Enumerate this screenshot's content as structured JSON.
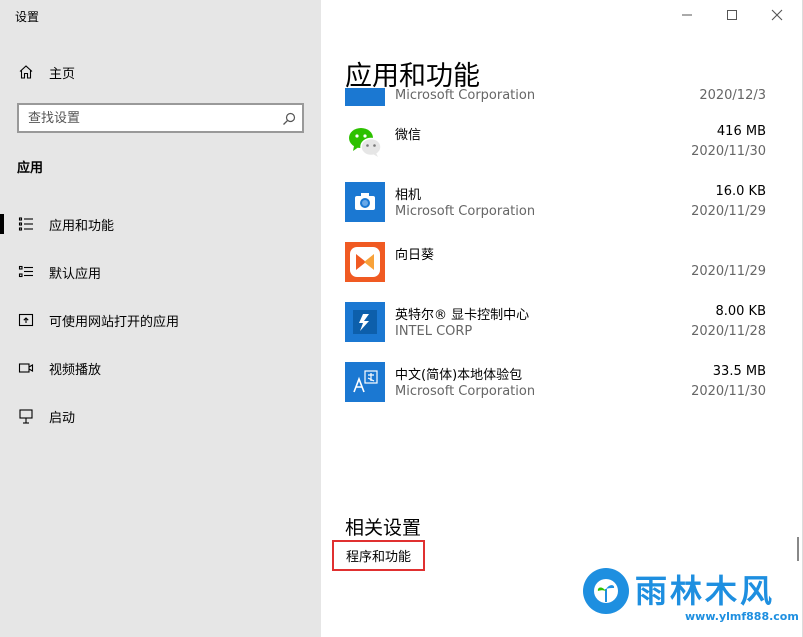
{
  "window": {
    "title": "设置"
  },
  "sidebar": {
    "home_label": "主页",
    "search": {
      "placeholder": "查找设置"
    },
    "section_label": "应用",
    "items": [
      {
        "label": "应用和功能",
        "icon": "apps-features-icon",
        "active": true
      },
      {
        "label": "默认应用",
        "icon": "default-apps-icon",
        "active": false
      },
      {
        "label": "可使用网站打开的应用",
        "icon": "apps-for-websites-icon",
        "active": false
      },
      {
        "label": "视频播放",
        "icon": "video-playback-icon",
        "active": false
      },
      {
        "label": "启动",
        "icon": "startup-icon",
        "active": false
      }
    ]
  },
  "main": {
    "page_title": "应用和功能",
    "partial_row": {
      "publisher": "Microsoft Corporation",
      "date": "2020/12/3"
    },
    "apps": [
      {
        "name": "微信",
        "publisher": "",
        "size": "416 MB",
        "date": "2020/11/30",
        "icon": "wechat-icon",
        "icon_color": "#ffffff"
      },
      {
        "name": "相机",
        "publisher": "Microsoft Corporation",
        "size": "16.0 KB",
        "date": "2020/11/29",
        "icon": "camera-icon",
        "icon_color": "#1b78d2"
      },
      {
        "name": "向日葵",
        "publisher": "",
        "size": "",
        "date": "2020/11/29",
        "icon": "sunflower-icon",
        "icon_color": "#f05a22"
      },
      {
        "name": "英特尔® 显卡控制中心",
        "publisher": "INTEL CORP",
        "size": "8.00 KB",
        "date": "2020/11/28",
        "icon": "intel-graphics-icon",
        "icon_color": "#1b78d2"
      },
      {
        "name": "中文(简体)本地体验包",
        "publisher": "Microsoft Corporation",
        "size": "33.5 MB",
        "date": "2020/11/30",
        "icon": "language-pack-icon",
        "icon_color": "#1b78d2"
      }
    ],
    "related_title": "相关设置",
    "related_link": "程序和功能"
  },
  "watermark": {
    "text": "雨林木风",
    "url": "www.ylmf888.com"
  },
  "colors": {
    "accent": "#1b78d2",
    "sidebar_bg": "#e6e6e6",
    "highlight_border": "#e03030",
    "watermark": "#1e8fe0"
  }
}
